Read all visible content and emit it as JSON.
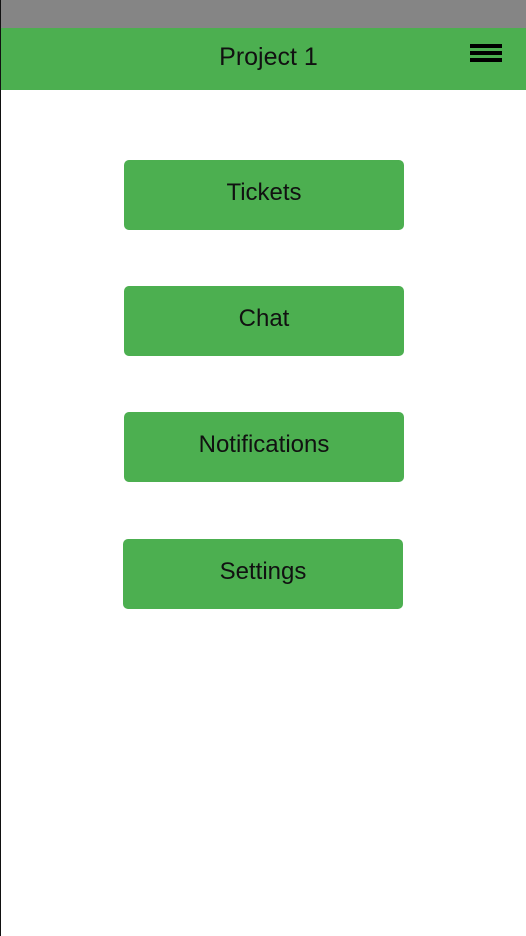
{
  "app_bar": {
    "title": "Project 1",
    "menu_icon": "hamburger-menu-icon"
  },
  "colors": {
    "accent": "#4caf50",
    "status_bar": "#858585",
    "background": "#ffffff",
    "text": "#111111"
  },
  "main": {
    "buttons": [
      {
        "label": "Tickets"
      },
      {
        "label": "Chat"
      },
      {
        "label": "Notifications"
      },
      {
        "label": "Settings"
      }
    ]
  }
}
